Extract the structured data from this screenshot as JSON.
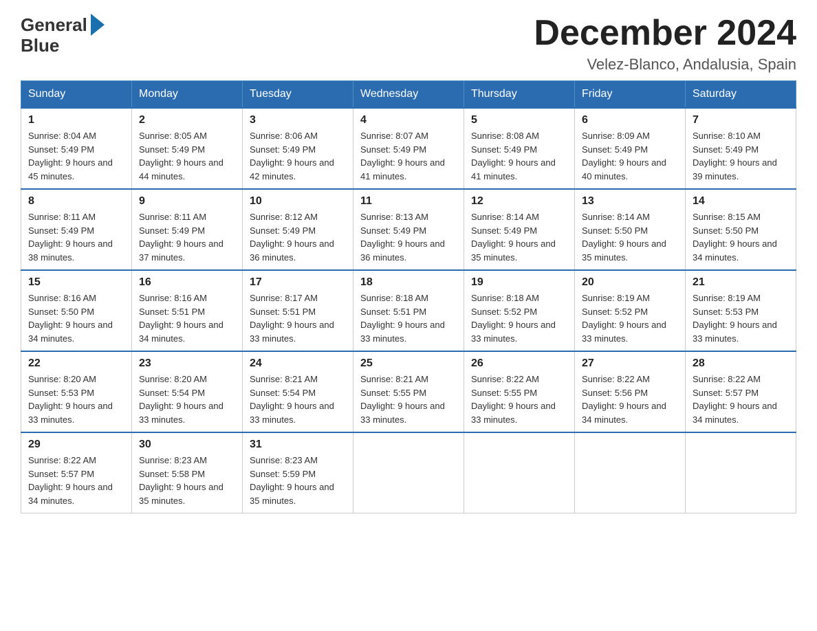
{
  "logo": {
    "part1": "General",
    "part2": "Blue"
  },
  "title": "December 2024",
  "location": "Velez-Blanco, Andalusia, Spain",
  "days_of_week": [
    "Sunday",
    "Monday",
    "Tuesday",
    "Wednesday",
    "Thursday",
    "Friday",
    "Saturday"
  ],
  "weeks": [
    [
      {
        "day": "1",
        "sunrise": "8:04 AM",
        "sunset": "5:49 PM",
        "daylight": "9 hours and 45 minutes."
      },
      {
        "day": "2",
        "sunrise": "8:05 AM",
        "sunset": "5:49 PM",
        "daylight": "9 hours and 44 minutes."
      },
      {
        "day": "3",
        "sunrise": "8:06 AM",
        "sunset": "5:49 PM",
        "daylight": "9 hours and 42 minutes."
      },
      {
        "day": "4",
        "sunrise": "8:07 AM",
        "sunset": "5:49 PM",
        "daylight": "9 hours and 41 minutes."
      },
      {
        "day": "5",
        "sunrise": "8:08 AM",
        "sunset": "5:49 PM",
        "daylight": "9 hours and 41 minutes."
      },
      {
        "day": "6",
        "sunrise": "8:09 AM",
        "sunset": "5:49 PM",
        "daylight": "9 hours and 40 minutes."
      },
      {
        "day": "7",
        "sunrise": "8:10 AM",
        "sunset": "5:49 PM",
        "daylight": "9 hours and 39 minutes."
      }
    ],
    [
      {
        "day": "8",
        "sunrise": "8:11 AM",
        "sunset": "5:49 PM",
        "daylight": "9 hours and 38 minutes."
      },
      {
        "day": "9",
        "sunrise": "8:11 AM",
        "sunset": "5:49 PM",
        "daylight": "9 hours and 37 minutes."
      },
      {
        "day": "10",
        "sunrise": "8:12 AM",
        "sunset": "5:49 PM",
        "daylight": "9 hours and 36 minutes."
      },
      {
        "day": "11",
        "sunrise": "8:13 AM",
        "sunset": "5:49 PM",
        "daylight": "9 hours and 36 minutes."
      },
      {
        "day": "12",
        "sunrise": "8:14 AM",
        "sunset": "5:49 PM",
        "daylight": "9 hours and 35 minutes."
      },
      {
        "day": "13",
        "sunrise": "8:14 AM",
        "sunset": "5:50 PM",
        "daylight": "9 hours and 35 minutes."
      },
      {
        "day": "14",
        "sunrise": "8:15 AM",
        "sunset": "5:50 PM",
        "daylight": "9 hours and 34 minutes."
      }
    ],
    [
      {
        "day": "15",
        "sunrise": "8:16 AM",
        "sunset": "5:50 PM",
        "daylight": "9 hours and 34 minutes."
      },
      {
        "day": "16",
        "sunrise": "8:16 AM",
        "sunset": "5:51 PM",
        "daylight": "9 hours and 34 minutes."
      },
      {
        "day": "17",
        "sunrise": "8:17 AM",
        "sunset": "5:51 PM",
        "daylight": "9 hours and 33 minutes."
      },
      {
        "day": "18",
        "sunrise": "8:18 AM",
        "sunset": "5:51 PM",
        "daylight": "9 hours and 33 minutes."
      },
      {
        "day": "19",
        "sunrise": "8:18 AM",
        "sunset": "5:52 PM",
        "daylight": "9 hours and 33 minutes."
      },
      {
        "day": "20",
        "sunrise": "8:19 AM",
        "sunset": "5:52 PM",
        "daylight": "9 hours and 33 minutes."
      },
      {
        "day": "21",
        "sunrise": "8:19 AM",
        "sunset": "5:53 PM",
        "daylight": "9 hours and 33 minutes."
      }
    ],
    [
      {
        "day": "22",
        "sunrise": "8:20 AM",
        "sunset": "5:53 PM",
        "daylight": "9 hours and 33 minutes."
      },
      {
        "day": "23",
        "sunrise": "8:20 AM",
        "sunset": "5:54 PM",
        "daylight": "9 hours and 33 minutes."
      },
      {
        "day": "24",
        "sunrise": "8:21 AM",
        "sunset": "5:54 PM",
        "daylight": "9 hours and 33 minutes."
      },
      {
        "day": "25",
        "sunrise": "8:21 AM",
        "sunset": "5:55 PM",
        "daylight": "9 hours and 33 minutes."
      },
      {
        "day": "26",
        "sunrise": "8:22 AM",
        "sunset": "5:55 PM",
        "daylight": "9 hours and 33 minutes."
      },
      {
        "day": "27",
        "sunrise": "8:22 AM",
        "sunset": "5:56 PM",
        "daylight": "9 hours and 34 minutes."
      },
      {
        "day": "28",
        "sunrise": "8:22 AM",
        "sunset": "5:57 PM",
        "daylight": "9 hours and 34 minutes."
      }
    ],
    [
      {
        "day": "29",
        "sunrise": "8:22 AM",
        "sunset": "5:57 PM",
        "daylight": "9 hours and 34 minutes."
      },
      {
        "day": "30",
        "sunrise": "8:23 AM",
        "sunset": "5:58 PM",
        "daylight": "9 hours and 35 minutes."
      },
      {
        "day": "31",
        "sunrise": "8:23 AM",
        "sunset": "5:59 PM",
        "daylight": "9 hours and 35 minutes."
      },
      null,
      null,
      null,
      null
    ]
  ]
}
